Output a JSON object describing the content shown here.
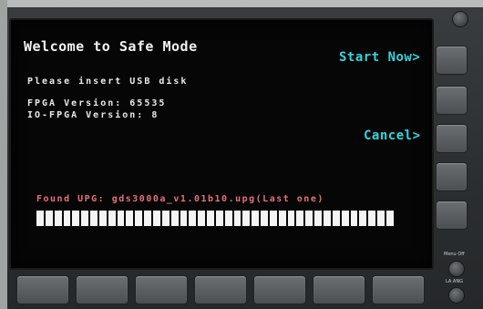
{
  "screen": {
    "title": "Welcome to Safe Mode",
    "instruction": "Please insert USB disk",
    "fpga_version": "FPGA Version: 65535",
    "io_fpga_version": "IO-FPGA Version: 8",
    "found_text": "Found UPG: gds3000a_v1.01b10.upg(Last one)",
    "progress": 1.0
  },
  "softkeys": {
    "start_label": "Start Now>",
    "cancel_label": "Cancel>"
  },
  "panel": {
    "menu_label": "Menu Off",
    "ang_label": "LA ANG"
  },
  "colors": {
    "softkey": "#33d6dc",
    "found_text": "#e8707a",
    "progress_fill": "#f4f4f4"
  }
}
